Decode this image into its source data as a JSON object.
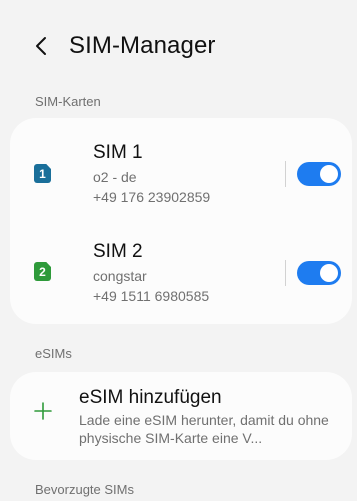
{
  "header": {
    "back_icon": "chevron-left-icon",
    "title": "SIM-Manager"
  },
  "sim_cards": {
    "section_label": "SIM-Karten",
    "items": [
      {
        "badge": "1",
        "badge_color": "#1a6f9a",
        "name": "SIM 1",
        "carrier": "o2 - de",
        "number": "+49 176 23902859",
        "enabled": true
      },
      {
        "badge": "2",
        "badge_color": "#2e9a3a",
        "name": "SIM 2",
        "carrier": "congstar",
        "number": "+49 1511 6980585",
        "enabled": true
      }
    ]
  },
  "esims": {
    "section_label": "eSIMs",
    "add_icon": "plus-icon",
    "add_title": "eSIM hinzufügen",
    "add_desc": "Lade eine eSIM herunter, damit du ohne physische SIM-Karte eine V..."
  },
  "preferred": {
    "section_label": "Bevorzugte SIMs"
  },
  "colors": {
    "accent": "#1e7cf0",
    "background": "#f3f3f3",
    "card": "#fcfcfc",
    "esim_plus": "#2e9a3a"
  }
}
